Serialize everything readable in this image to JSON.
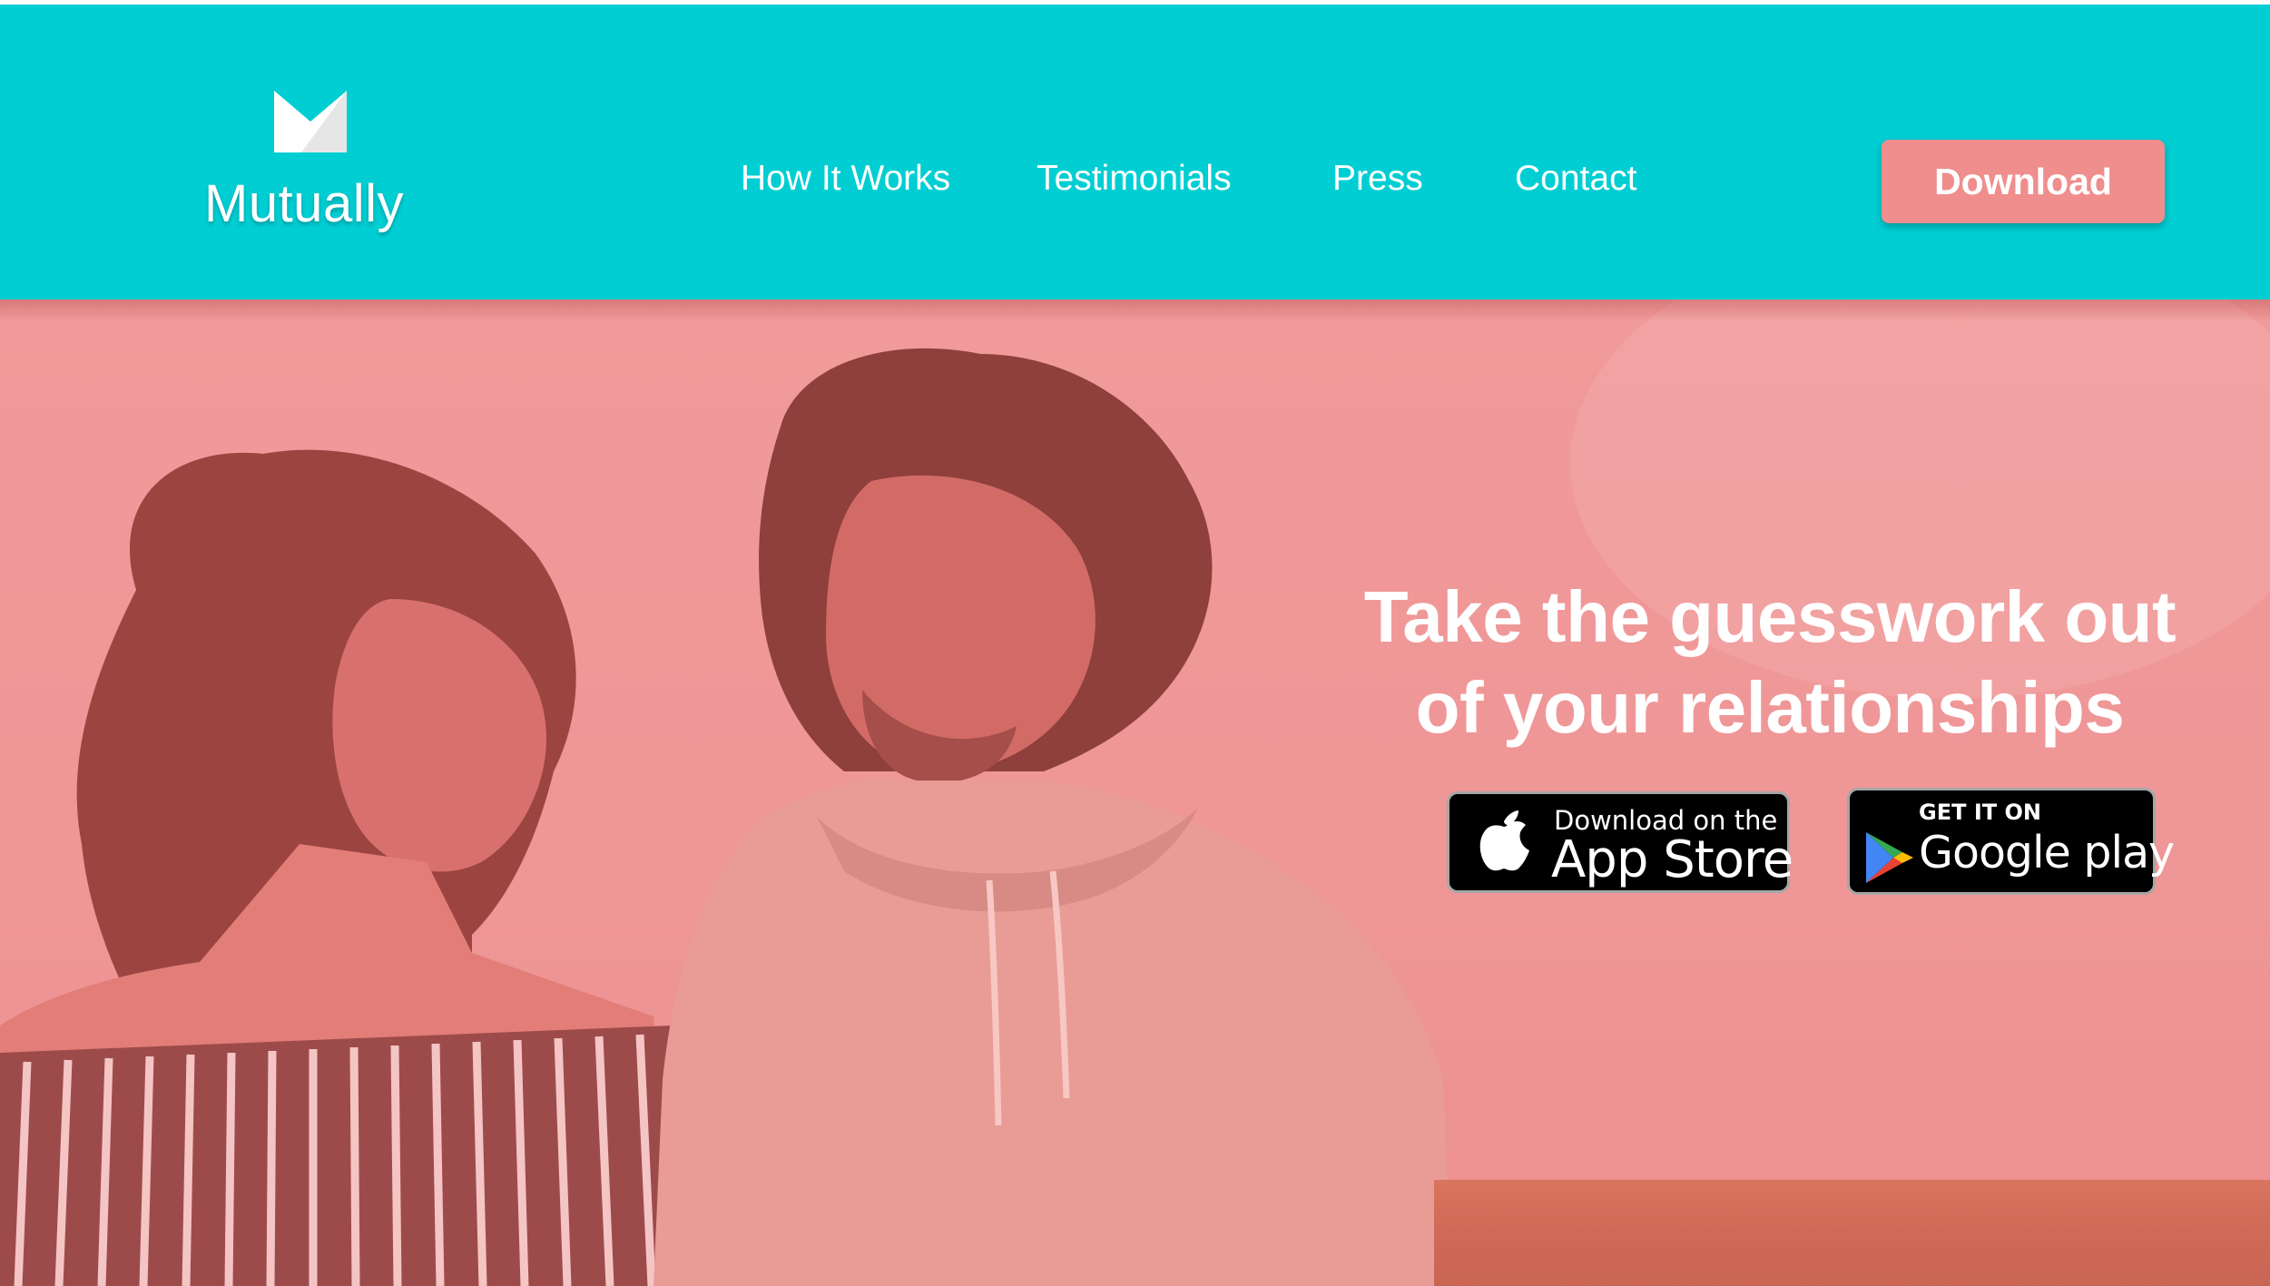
{
  "brand": {
    "name": "Mutually",
    "logo_icon": "envelope-m-logo-icon"
  },
  "nav": {
    "items": [
      {
        "label": "How It Works"
      },
      {
        "label": "Testimonials"
      },
      {
        "label": "Press"
      },
      {
        "label": "Contact"
      }
    ],
    "download_label": "Download"
  },
  "hero": {
    "headline_line1": "Take the guesswork out",
    "headline_line2": "of your relationships",
    "background_image": "couple-sitting-photo",
    "overlay_color": "#f09a9b",
    "app_store": {
      "small": "Download on the",
      "large": "App Store",
      "icon": "apple-icon"
    },
    "google_play": {
      "small": "GET IT ON",
      "large": "Google play",
      "icon": "play-triangle-icon"
    }
  },
  "colors": {
    "header_bg": "#00ced3",
    "accent": "#ef8e8d",
    "text": "#ffffff"
  }
}
